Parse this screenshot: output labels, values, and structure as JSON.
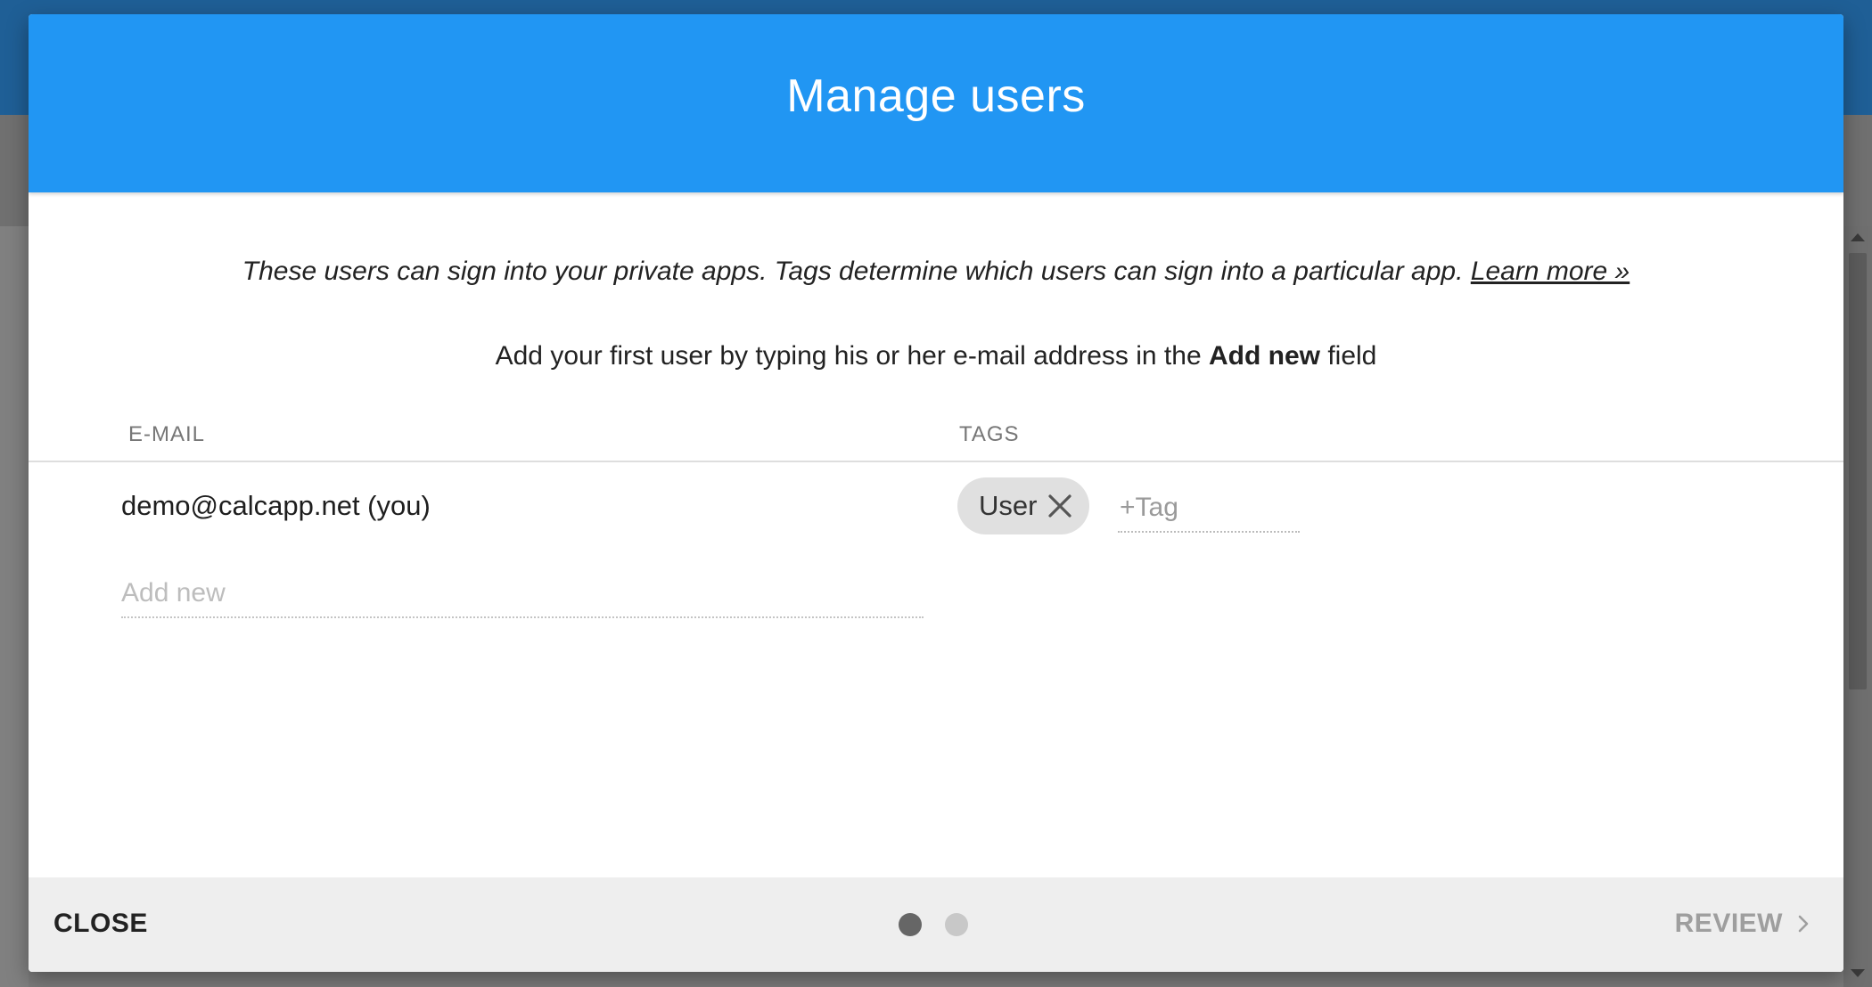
{
  "dialog": {
    "title": "Manage users",
    "intro_text": "These users can sign into your private apps. Tags determine which users can sign into a particular app.",
    "learn_more_label": "Learn more »",
    "instruction_prefix": "Add your first user by typing his or her e-mail address in the",
    "instruction_bold": "Add new",
    "instruction_suffix": "field"
  },
  "table": {
    "email_header": "E-MAIL",
    "tags_header": "TAGS",
    "users": [
      {
        "email": "demo@calcapp.net (you)",
        "tags": [
          "User"
        ],
        "tag_placeholder": "+Tag"
      }
    ],
    "add_new_placeholder": "Add new"
  },
  "footer": {
    "close_label": "CLOSE",
    "review_label": "REVIEW",
    "pages": 2,
    "current_page": 1
  },
  "colors": {
    "header": "#2196f3",
    "footer": "#eeeeee",
    "chip": "#e0e0e0",
    "dot_active": "#666666",
    "dot_inactive": "#c8c8c8"
  },
  "icons": {
    "chip_remove": "close-icon",
    "review_chevron": "chevron-right-icon",
    "scroll_up": "arrow-up-icon",
    "scroll_down": "arrow-down-icon"
  }
}
